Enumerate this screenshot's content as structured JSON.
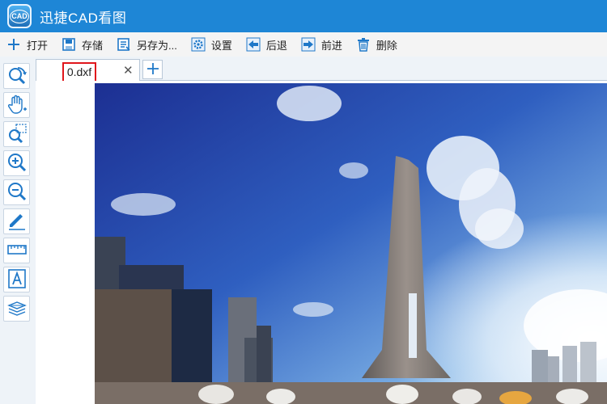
{
  "app": {
    "title": "迅捷CAD看图",
    "logo_text": "CAD"
  },
  "toolbar": {
    "items": [
      {
        "label": "打开",
        "icon": "plus-icon"
      },
      {
        "label": "存储",
        "icon": "save-icon"
      },
      {
        "label": "另存为...",
        "icon": "save-as-icon"
      },
      {
        "label": "设置",
        "icon": "gear-icon"
      },
      {
        "label": "后退",
        "icon": "arrow-left-icon"
      },
      {
        "label": "前进",
        "icon": "arrow-right-icon"
      },
      {
        "label": "删除",
        "icon": "trash-icon"
      }
    ]
  },
  "left_tools": [
    {
      "icon": "zoom-back-icon"
    },
    {
      "icon": "pan-hand-icon"
    },
    {
      "icon": "zoom-window-icon"
    },
    {
      "icon": "zoom-in-icon"
    },
    {
      "icon": "zoom-out-icon"
    },
    {
      "icon": "pen-icon"
    },
    {
      "icon": "measure-ruler-icon"
    },
    {
      "icon": "text-a-icon"
    },
    {
      "icon": "layers-icon"
    }
  ],
  "tabs": [
    {
      "label": "0.dxf"
    }
  ],
  "colors": {
    "titlebar": "#1e86d6",
    "icon_blue": "#1f78c8",
    "highlight": "#e0161b"
  }
}
